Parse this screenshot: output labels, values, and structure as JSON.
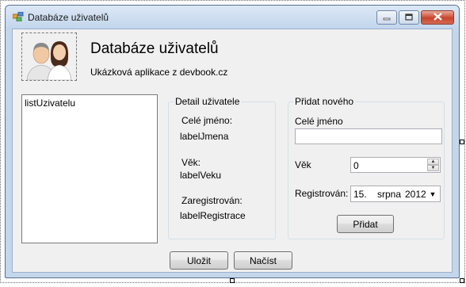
{
  "window": {
    "title": "Databáze uživatelů",
    "icon": "windows-form-icon",
    "buttons": [
      "minimize-icon",
      "maximize-icon",
      "close-icon"
    ]
  },
  "header": {
    "title": "Databáze uživatelů",
    "subtitle": "Ukázková aplikace z devbook.cz",
    "avatar_icon": "users-avatar-icon"
  },
  "list": {
    "label": "listUzivatelu"
  },
  "detail": {
    "group_title": "Detail uživatele",
    "name_caption": "Celé jméno:",
    "name_value": "labelJmena",
    "age_caption": "Věk:",
    "age_value": "labelVeku",
    "registered_caption": "Zaregistrován:",
    "registered_value": "labelRegistrace"
  },
  "new_user": {
    "group_title": "Přidat nového",
    "name_label": "Celé jméno",
    "name_value": "",
    "age_label": "Věk",
    "age_value": "0",
    "registered_label": "Registrován:",
    "date_day": "15.",
    "date_month": "srpna",
    "date_year": "2012",
    "add_button": "Přidat"
  },
  "actions": {
    "save_button": "Uložit",
    "load_button": "Načíst"
  },
  "colors": {
    "window_frame": "#c4d6ea",
    "client_background": "#f0f0f0",
    "close_button": "#c8442c"
  }
}
